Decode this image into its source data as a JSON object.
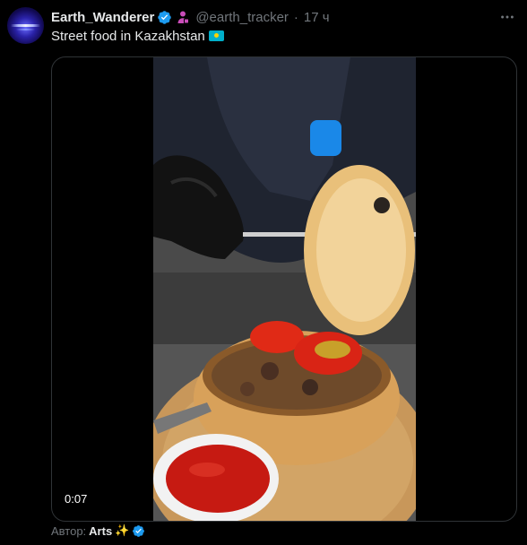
{
  "post": {
    "display_name": "Earth_Wanderer",
    "handle": "@earth_tracker",
    "separator": "·",
    "time": "17 ч",
    "text": "Street food in Kazakhstan",
    "verified_icon": "verified-badge-icon",
    "affiliate_icon": "affiliate-person-icon",
    "more_icon": "more-dots-icon",
    "flag_icon": "kazakhstan-flag-icon"
  },
  "media": {
    "duration": "0:07"
  },
  "footer": {
    "label": "Автор:",
    "author": "Arts",
    "sparkle": "✨"
  },
  "colors": {
    "background": "#000000",
    "text": "#e7e9ea",
    "muted": "#71767b",
    "verified": "#1d9bf0",
    "affiliate": "#c94db9"
  }
}
